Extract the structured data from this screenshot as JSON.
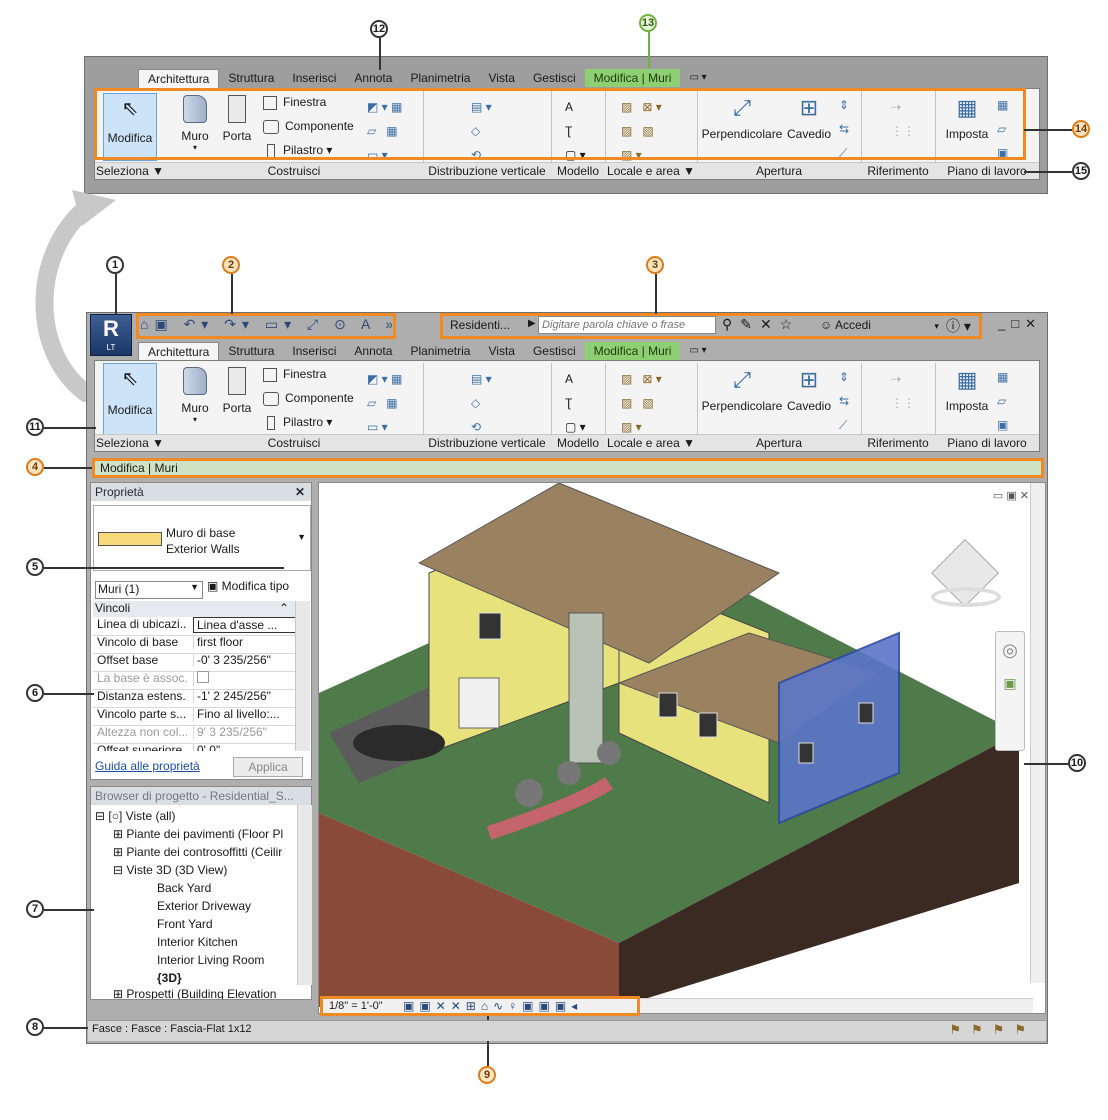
{
  "callouts": [
    "1",
    "2",
    "3",
    "4",
    "5",
    "6",
    "7",
    "8",
    "9",
    "10",
    "11",
    "12",
    "13",
    "14",
    "15"
  ],
  "ribbon_tabs": [
    "Architettura",
    "Struttura",
    "Inserisci",
    "Annota",
    "Planimetria",
    "Vista",
    "Gestisci",
    "Modifica | Muri"
  ],
  "ribbon": {
    "modifica": "Modifica",
    "muro": "Muro",
    "porta": "Porta",
    "finestra": "Finestra",
    "componente": "Componente",
    "pilastro": "Pilastro",
    "perpendicolare": "Perpendicolare",
    "cavedio": "Cavedio",
    "imposta": "Imposta",
    "panels": [
      "Seleziona ▼",
      "Costruisci",
      "Distribuzione verticale",
      "Modello",
      "Locale e area ▼",
      "Apertura",
      "Riferimento",
      "Piano di lavoro"
    ]
  },
  "quick_access": {
    "project": "Residenti...",
    "search_placeholder": "Digitare parola chiave o frase",
    "signin": "Accedi",
    "app_badge": "LT",
    "window_controls": [
      "_",
      "□",
      "✕"
    ]
  },
  "options_bar": "Modifica | Muri",
  "properties": {
    "title": "Proprietà",
    "type_line1": "Muro di base",
    "type_line2": "Exterior Walls",
    "selector": "Muri (1)",
    "edit_type": "Modifica tipo",
    "group": "Vincoli",
    "rows": [
      {
        "k": "Linea di ubicazi...",
        "v": "Linea d'asse ..."
      },
      {
        "k": "Vincolo di base",
        "v": "first floor"
      },
      {
        "k": "Offset base",
        "v": "-0'  3 235/256\""
      },
      {
        "k": "La base è assoc...",
        "v": ""
      },
      {
        "k": "Distanza estens...",
        "v": "-1'  2 245/256\""
      },
      {
        "k": "Vincolo parte s...",
        "v": "Fino al livello:..."
      },
      {
        "k": "Altezza non col...",
        "v": "9'  3 235/256\""
      },
      {
        "k": "Offset superiore",
        "v": "0'  0\""
      }
    ],
    "help_link": "Guida alle proprietà",
    "apply": "Applica"
  },
  "browser": {
    "title": "Browser di progetto - Residential_S...",
    "items": [
      "Viste (all)",
      "Piante dei pavimenti (Floor Pl",
      "Piante dei controsoffitti (Ceilir",
      "Viste 3D (3D View)",
      "Back Yard",
      "Exterior Driveway",
      "Front Yard",
      "Interior Kitchen",
      "Interior Living Room",
      "{3D}",
      "Prospetti (Building Elevation"
    ]
  },
  "view_scale": "1/8\" = 1'-0\"",
  "status_text": "Fasce : Fasce : Fascia-Flat 1x12",
  "colors": {
    "highlight": "#f08a24",
    "contextual": "#8fcf73",
    "frame": "#a9a9a9"
  }
}
